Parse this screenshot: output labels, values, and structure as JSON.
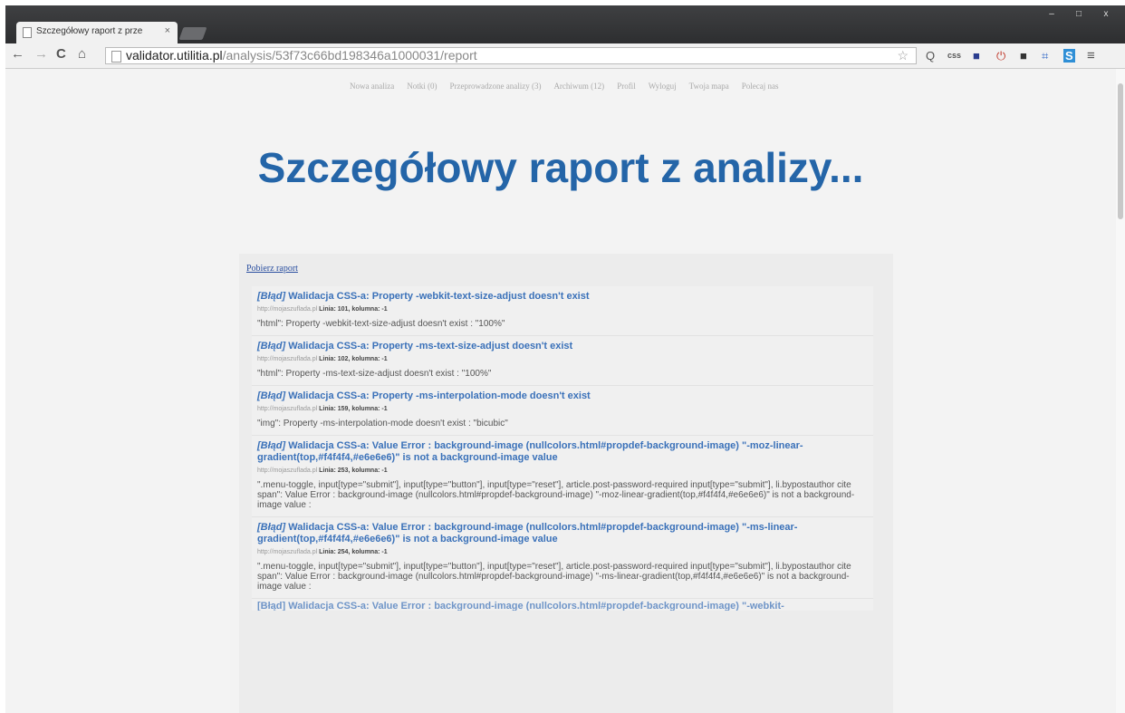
{
  "browser": {
    "tab_title": "Szczegółowy raport z prze",
    "tab_close": "×",
    "window_buttons": [
      "–",
      "□",
      "x"
    ],
    "url_host": "validator.utilitia.pl",
    "url_path": "/analysis/53f73c66bd198346a1000031/report",
    "nav": {
      "back": "←",
      "forward": "→",
      "reload": "C",
      "home": "⌂"
    },
    "star": "☆",
    "extensions": [
      "Q",
      "css",
      "■",
      "⏻",
      "■",
      "⌗",
      "S",
      "≡"
    ]
  },
  "page": {
    "nav_links": [
      "Nowa analiza",
      "Notki (0)",
      "Przeprowadzone analizy (3)",
      "Archiwum (12)",
      "Profil",
      "Wyloguj",
      "Twoja mapa",
      "Polecaj nas"
    ],
    "title": "Szczegółowy raport z analizy...",
    "download_link": "Pobierz raport",
    "items": [
      {
        "tag": "[Błąd]",
        "title": "Walidacja CSS-a: Property -webkit-text-size-adjust doesn't exist",
        "source": "http://mojaszuflada.pl",
        "line_label": "Linia",
        "line": "101",
        "col_label": "kolumna",
        "col": "-1",
        "message": "\"html\": Property -webkit-text-size-adjust doesn't exist : \"100%\""
      },
      {
        "tag": "[Błąd]",
        "title": "Walidacja CSS-a: Property -ms-text-size-adjust doesn't exist",
        "source": "http://mojaszuflada.pl",
        "line_label": "Linia",
        "line": "102",
        "col_label": "kolumna",
        "col": "-1",
        "message": "\"html\": Property -ms-text-size-adjust doesn't exist : \"100%\""
      },
      {
        "tag": "[Błąd]",
        "title": "Walidacja CSS-a: Property -ms-interpolation-mode doesn't exist",
        "source": "http://mojaszuflada.pl",
        "line_label": "Linia",
        "line": "159",
        "col_label": "kolumna",
        "col": "-1",
        "message": "\"img\": Property -ms-interpolation-mode doesn't exist : \"bicubic\""
      },
      {
        "tag": "[Błąd]",
        "title": "Walidacja CSS-a: Value Error : background-image (nullcolors.html#propdef-background-image) \"-moz-linear-gradient(top,#f4f4f4,#e6e6e6)\" is not a background-image value",
        "source": "http://mojaszuflada.pl",
        "line_label": "Linia",
        "line": "253",
        "col_label": "kolumna",
        "col": "-1",
        "message": "\".menu-toggle, input[type=\"submit\"], input[type=\"button\"], input[type=\"reset\"], article.post-password-required input[type=\"submit\"], li.bypostauthor cite span\": Value Error : background-image (nullcolors.html#propdef-background-image) \"-moz-linear-gradient(top,#f4f4f4,#e6e6e6)\" is not a background-image value :"
      },
      {
        "tag": "[Błąd]",
        "title": "Walidacja CSS-a: Value Error : background-image (nullcolors.html#propdef-background-image) \"-ms-linear-gradient(top,#f4f4f4,#e6e6e6)\" is not a background-image value",
        "source": "http://mojaszuflada.pl",
        "line_label": "Linia",
        "line": "254",
        "col_label": "kolumna",
        "col": "-1",
        "message": "\".menu-toggle, input[type=\"submit\"], input[type=\"button\"], input[type=\"reset\"], article.post-password-required input[type=\"submit\"], li.bypostauthor cite span\": Value Error : background-image (nullcolors.html#propdef-background-image) \"-ms-linear-gradient(top,#f4f4f4,#e6e6e6)\" is not a background-image value :"
      }
    ],
    "cutoff_text": "[Błąd] Walidacja CSS-a: Value Error : background-image (nullcolors.html#propdef-background-image) \"-webkit-"
  },
  "colors": {
    "title": "#2465a8",
    "link": "#3a71b9",
    "panel": "#ececec"
  }
}
